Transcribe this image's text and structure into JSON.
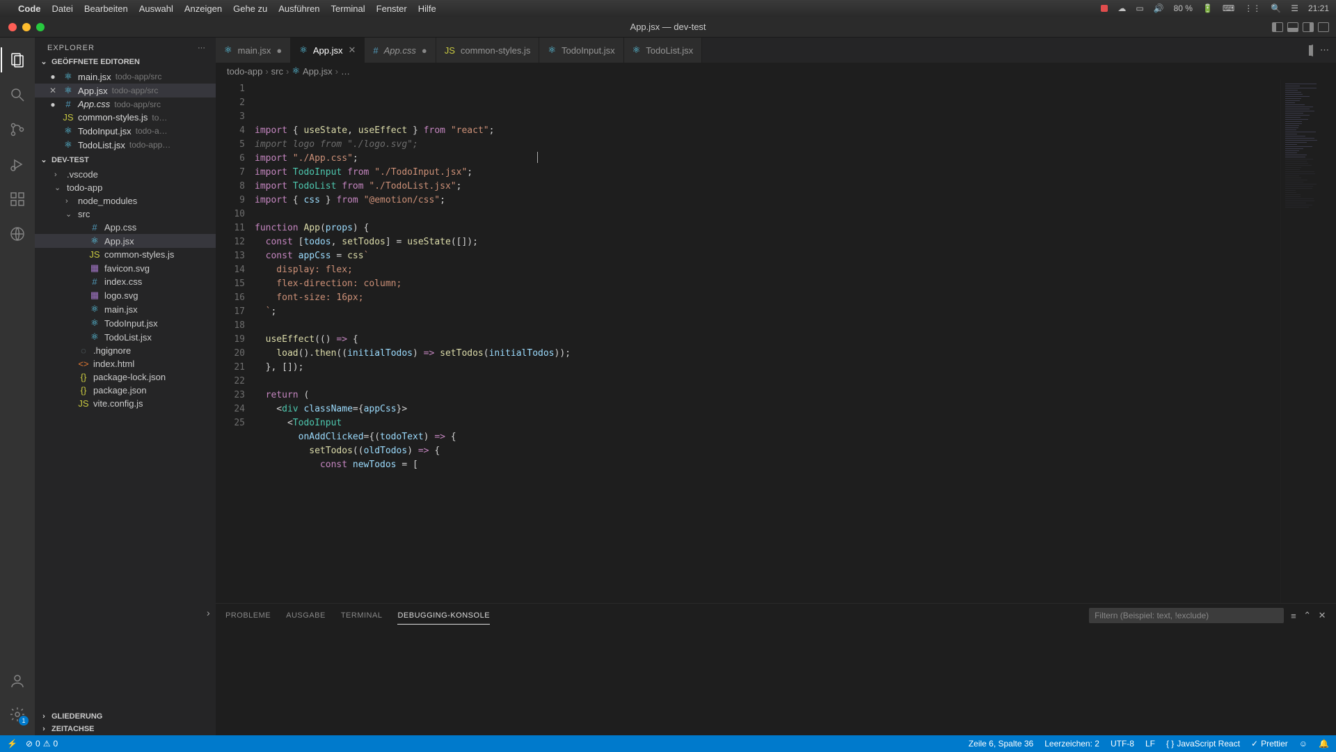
{
  "macos": {
    "app_name": "Code",
    "menu": [
      "Datei",
      "Bearbeiten",
      "Auswahl",
      "Anzeigen",
      "Gehe zu",
      "Ausführen",
      "Terminal",
      "Fenster",
      "Hilfe"
    ],
    "battery": "80 %",
    "time": "21:21"
  },
  "titlebar": {
    "title": "App.jsx — dev-test"
  },
  "sidebar": {
    "title": "EXPLORER",
    "open_editors_label": "GEÖFFNETE EDITOREN",
    "open_editors": [
      {
        "name": "main.jsx",
        "path": "todo-app/src",
        "icon": "react",
        "modified": true
      },
      {
        "name": "App.jsx",
        "path": "todo-app/src",
        "icon": "react",
        "active": true,
        "x": true
      },
      {
        "name": "App.css",
        "path": "todo-app/src",
        "icon": "css",
        "modified": true,
        "italic": true
      },
      {
        "name": "common-styles.js",
        "path": "to…",
        "icon": "js"
      },
      {
        "name": "TodoInput.jsx",
        "path": "todo-a…",
        "icon": "react"
      },
      {
        "name": "TodoList.jsx",
        "path": "todo-app…",
        "icon": "react"
      }
    ],
    "project_label": "DEV-TEST",
    "tree": [
      {
        "name": ".vscode",
        "type": "folder",
        "depth": 1,
        "open": false
      },
      {
        "name": "todo-app",
        "type": "folder",
        "depth": 1,
        "open": true
      },
      {
        "name": "node_modules",
        "type": "folder",
        "depth": 2,
        "open": false
      },
      {
        "name": "src",
        "type": "folder",
        "depth": 2,
        "open": true
      },
      {
        "name": "App.css",
        "type": "file",
        "depth": 3,
        "icon": "css"
      },
      {
        "name": "App.jsx",
        "type": "file",
        "depth": 3,
        "icon": "react",
        "selected": true
      },
      {
        "name": "common-styles.js",
        "type": "file",
        "depth": 3,
        "icon": "js"
      },
      {
        "name": "favicon.svg",
        "type": "file",
        "depth": 3,
        "icon": "svg"
      },
      {
        "name": "index.css",
        "type": "file",
        "depth": 3,
        "icon": "css"
      },
      {
        "name": "logo.svg",
        "type": "file",
        "depth": 3,
        "icon": "svg"
      },
      {
        "name": "main.jsx",
        "type": "file",
        "depth": 3,
        "icon": "react"
      },
      {
        "name": "TodoInput.jsx",
        "type": "file",
        "depth": 3,
        "icon": "react"
      },
      {
        "name": "TodoList.jsx",
        "type": "file",
        "depth": 3,
        "icon": "react"
      },
      {
        "name": ".hgignore",
        "type": "file",
        "depth": 2,
        "icon": "hg"
      },
      {
        "name": "index.html",
        "type": "file",
        "depth": 2,
        "icon": "html"
      },
      {
        "name": "package-lock.json",
        "type": "file",
        "depth": 2,
        "icon": "json"
      },
      {
        "name": "package.json",
        "type": "file",
        "depth": 2,
        "icon": "json"
      },
      {
        "name": "vite.config.js",
        "type": "file",
        "depth": 2,
        "icon": "js"
      }
    ],
    "outline_label": "GLIEDERUNG",
    "timeline_label": "ZEITACHSE"
  },
  "tabs": [
    {
      "label": "main.jsx",
      "icon": "react",
      "modified": true
    },
    {
      "label": "App.jsx",
      "icon": "react",
      "active": true
    },
    {
      "label": "App.css",
      "icon": "css",
      "italic": true,
      "modified": true
    },
    {
      "label": "common-styles.js",
      "icon": "js"
    },
    {
      "label": "TodoInput.jsx",
      "icon": "react"
    },
    {
      "label": "TodoList.jsx",
      "icon": "react"
    }
  ],
  "breadcrumb": [
    "todo-app",
    "src",
    "App.jsx",
    "…"
  ],
  "code": {
    "lines": [
      [
        [
          "kw",
          "import"
        ],
        [
          "pun",
          " { "
        ],
        [
          "fn",
          "useState"
        ],
        [
          "pun",
          ", "
        ],
        [
          "fn",
          "useEffect"
        ],
        [
          "pun",
          " } "
        ],
        [
          "kw",
          "from"
        ],
        [
          "pun",
          " "
        ],
        [
          "str",
          "\"react\""
        ],
        [
          "pun",
          ";"
        ]
      ],
      [
        [
          "dim",
          "import"
        ],
        [
          "dim",
          " "
        ],
        [
          "dim",
          "logo"
        ],
        [
          "dim",
          " "
        ],
        [
          "dim",
          "from"
        ],
        [
          "dim",
          " "
        ],
        [
          "dim",
          "\"./logo.svg\""
        ],
        [
          "dim",
          ";"
        ]
      ],
      [
        [
          "kw",
          "import"
        ],
        [
          "pun",
          " "
        ],
        [
          "str",
          "\"./App.css\""
        ],
        [
          "pun",
          ";"
        ]
      ],
      [
        [
          "kw",
          "import"
        ],
        [
          "pun",
          " "
        ],
        [
          "typ",
          "TodoInput"
        ],
        [
          "pun",
          " "
        ],
        [
          "kw",
          "from"
        ],
        [
          "pun",
          " "
        ],
        [
          "str",
          "\"./TodoInput.jsx\""
        ],
        [
          "pun",
          ";"
        ]
      ],
      [
        [
          "kw",
          "import"
        ],
        [
          "pun",
          " "
        ],
        [
          "typ",
          "TodoList"
        ],
        [
          "pun",
          " "
        ],
        [
          "kw",
          "from"
        ],
        [
          "pun",
          " "
        ],
        [
          "str",
          "\"./TodoList.jsx\""
        ],
        [
          "pun",
          ";"
        ]
      ],
      [
        [
          "kw",
          "import"
        ],
        [
          "pun",
          " { "
        ],
        [
          "id",
          "css"
        ],
        [
          "pun",
          " } "
        ],
        [
          "kw",
          "from"
        ],
        [
          "pun",
          " "
        ],
        [
          "str",
          "\"@emotion/css\""
        ],
        [
          "pun",
          ";"
        ]
      ],
      [],
      [
        [
          "kw",
          "function"
        ],
        [
          "pun",
          " "
        ],
        [
          "fn",
          "App"
        ],
        [
          "pun",
          "("
        ],
        [
          "id",
          "props"
        ],
        [
          "pun",
          ") {"
        ]
      ],
      [
        [
          "pun",
          "  "
        ],
        [
          "kw",
          "const"
        ],
        [
          "pun",
          " ["
        ],
        [
          "id",
          "todos"
        ],
        [
          "pun",
          ", "
        ],
        [
          "fn",
          "setTodos"
        ],
        [
          "pun",
          "] = "
        ],
        [
          "fn",
          "useState"
        ],
        [
          "pun",
          "([]);"
        ]
      ],
      [
        [
          "pun",
          "  "
        ],
        [
          "kw",
          "const"
        ],
        [
          "pun",
          " "
        ],
        [
          "id",
          "appCss"
        ],
        [
          "pun",
          " = "
        ],
        [
          "fn",
          "css"
        ],
        [
          "str",
          "`"
        ]
      ],
      [
        [
          "str",
          "    display: flex;"
        ]
      ],
      [
        [
          "str",
          "    flex-direction: column;"
        ]
      ],
      [
        [
          "str",
          "    font-size: 16px;"
        ]
      ],
      [
        [
          "str",
          "  `"
        ],
        [
          "pun",
          ";"
        ]
      ],
      [],
      [
        [
          "pun",
          "  "
        ],
        [
          "fn",
          "useEffect"
        ],
        [
          "pun",
          "(() "
        ],
        [
          "kw",
          "=>"
        ],
        [
          "pun",
          " {"
        ]
      ],
      [
        [
          "pun",
          "    "
        ],
        [
          "fn",
          "load"
        ],
        [
          "pun",
          "()."
        ],
        [
          "fn",
          "then"
        ],
        [
          "pun",
          "(("
        ],
        [
          "id",
          "initialTodos"
        ],
        [
          "pun",
          ") "
        ],
        [
          "kw",
          "=>"
        ],
        [
          "pun",
          " "
        ],
        [
          "fn",
          "setTodos"
        ],
        [
          "pun",
          "("
        ],
        [
          "id",
          "initialTodos"
        ],
        [
          "pun",
          "));"
        ]
      ],
      [
        [
          "pun",
          "  }, []);"
        ]
      ],
      [],
      [
        [
          "pun",
          "  "
        ],
        [
          "kw",
          "return"
        ],
        [
          "pun",
          " ("
        ]
      ],
      [
        [
          "pun",
          "    <"
        ],
        [
          "typ",
          "div"
        ],
        [
          "pun",
          " "
        ],
        [
          "id",
          "className"
        ],
        [
          "pun",
          "={"
        ],
        [
          "id",
          "appCss"
        ],
        [
          "pun",
          "}>"
        ]
      ],
      [
        [
          "pun",
          "      <"
        ],
        [
          "typ",
          "TodoInput"
        ]
      ],
      [
        [
          "pun",
          "        "
        ],
        [
          "id",
          "onAddClicked"
        ],
        [
          "pun",
          "={("
        ],
        [
          "id",
          "todoText"
        ],
        [
          "pun",
          ") "
        ],
        [
          "kw",
          "=>"
        ],
        [
          "pun",
          " {"
        ]
      ],
      [
        [
          "pun",
          "          "
        ],
        [
          "fn",
          "setTodos"
        ],
        [
          "pun",
          "(("
        ],
        [
          "id",
          "oldTodos"
        ],
        [
          "pun",
          ") "
        ],
        [
          "kw",
          "=>"
        ],
        [
          "pun",
          " {"
        ]
      ],
      [
        [
          "pun",
          "            "
        ],
        [
          "kw",
          "const"
        ],
        [
          "pun",
          " "
        ],
        [
          "id",
          "newTodos"
        ],
        [
          "pun",
          " = ["
        ]
      ]
    ],
    "first_line": 1
  },
  "panel": {
    "tabs": [
      "PROBLEME",
      "AUSGABE",
      "TERMINAL",
      "DEBUGGING-KONSOLE"
    ],
    "active_tab": 3,
    "filter_placeholder": "Filtern (Beispiel: text, !exclude)"
  },
  "statusbar": {
    "errors": "0",
    "warnings": "0",
    "cursor": "Zeile 6, Spalte 36",
    "indent": "Leerzeichen: 2",
    "encoding": "UTF-8",
    "eol": "LF",
    "language": "JavaScript React",
    "prettier": "Prettier",
    "settings_badge": "1"
  }
}
